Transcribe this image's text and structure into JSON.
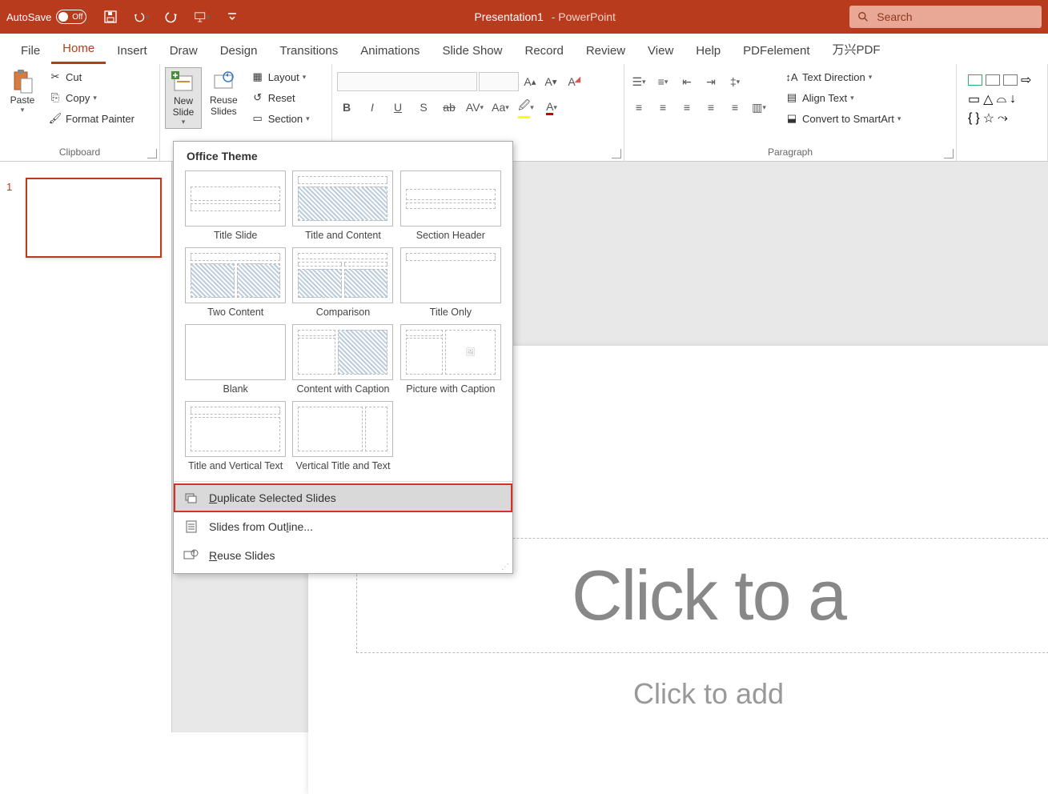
{
  "titlebar": {
    "autosave_label": "AutoSave",
    "autosave_state": "Off",
    "title_presentation": "Presentation1",
    "title_app": "-  PowerPoint",
    "search_placeholder": "Search"
  },
  "tabs": {
    "file": "File",
    "home": "Home",
    "insert": "Insert",
    "draw": "Draw",
    "design": "Design",
    "transitions": "Transitions",
    "animations": "Animations",
    "slideshow": "Slide Show",
    "record": "Record",
    "review": "Review",
    "view": "View",
    "help": "Help",
    "pdfelement": "PDFelement",
    "wanxing": "万兴PDF"
  },
  "ribbon": {
    "paste": "Paste",
    "cut": "Cut",
    "copy": "Copy",
    "format_painter": "Format Painter",
    "clipboard_label": "Clipboard",
    "new_slide": "New\nSlide",
    "reuse_slides": "Reuse\nSlides",
    "layout": "Layout",
    "reset": "Reset",
    "section": "Section",
    "text_direction": "Text Direction",
    "align_text": "Align Text",
    "convert_smartart": "Convert to SmartArt",
    "paragraph_label": "Paragraph"
  },
  "dropdown": {
    "header": "Office Theme",
    "layouts": [
      "Title Slide",
      "Title and Content",
      "Section Header",
      "Two Content",
      "Comparison",
      "Title Only",
      "Blank",
      "Content with Caption",
      "Picture with Caption",
      "Title and Vertical Text",
      "Vertical Title and Text"
    ],
    "duplicate": "Duplicate Selected Slides",
    "outline": "Slides from Outline...",
    "reuse": "Reuse Slides"
  },
  "slide": {
    "number": "1",
    "title_placeholder": "Click to a",
    "subtitle_placeholder": "Click to add"
  }
}
